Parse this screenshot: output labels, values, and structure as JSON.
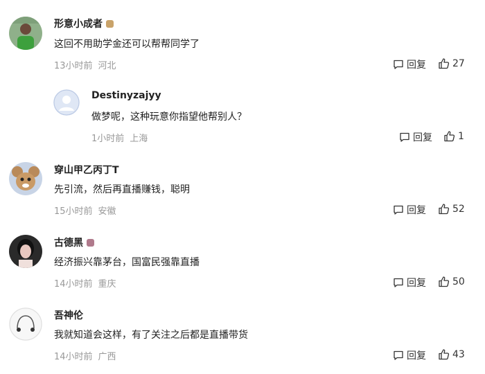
{
  "comments": [
    {
      "name": "形意小成者",
      "badge": true,
      "badge_color": "#c9a36a",
      "text": "这回不用助学金还可以帮帮同学了",
      "time": "13小时前",
      "location": "河北",
      "reply_label": "回复",
      "likes": "27",
      "avatar_icon": "person-green-shirt"
    },
    {
      "name": "Destinyzajyy",
      "badge": false,
      "text": "做梦呢，这种玩意你指望他帮别人？",
      "time": "1小时前",
      "location": "上海",
      "reply_label": "回复",
      "likes": "1",
      "avatar_icon": "default-user-silhouette"
    },
    {
      "name": "穿山甲乙丙丁T",
      "badge": false,
      "text": "先引流，然后再直播赚钱，聪明",
      "time": "15小时前",
      "location": "安徽",
      "reply_label": "回复",
      "likes": "52",
      "avatar_icon": "cartoon-mouse"
    },
    {
      "name": "古德黑",
      "badge": true,
      "badge_color": "#b07a8c",
      "text": "经济振兴靠茅台，国富民强靠直播",
      "time": "14小时前",
      "location": "重庆",
      "reply_label": "回复",
      "likes": "50",
      "avatar_icon": "woman-portrait"
    },
    {
      "name": "吾神伦",
      "badge": false,
      "text": "我就知道会这样，有了关注之后都是直播带货",
      "time": "14小时前",
      "location": "广西",
      "reply_label": "回复",
      "likes": "43",
      "avatar_icon": "earphones-sketch"
    }
  ]
}
